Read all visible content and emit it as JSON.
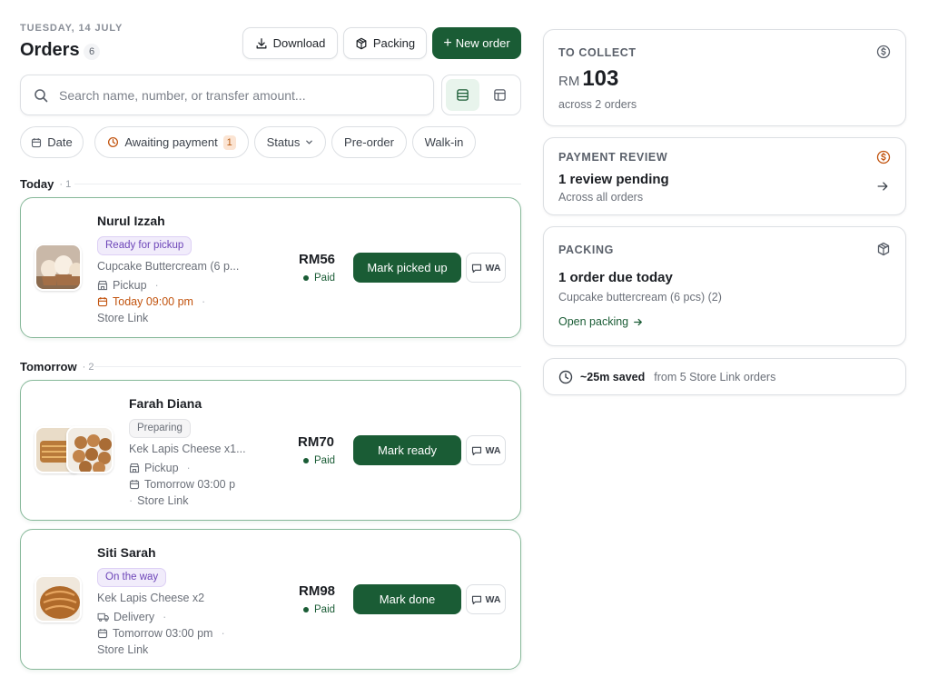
{
  "header": {
    "date": "TUESDAY, 14 JULY",
    "title": "Orders",
    "count": "6",
    "download_label": "Download",
    "packing_label": "Packing",
    "new_order_label": "New order"
  },
  "search": {
    "placeholder": "Search name, number, or transfer amount..."
  },
  "view_toggle": [
    "list-view",
    "table-view"
  ],
  "filters": {
    "date": "Date",
    "awaiting": "Awaiting payment",
    "awaiting_count": "1",
    "status": "Status",
    "preorder": "Pre-order",
    "walkin": "Walk-in"
  },
  "groups": [
    {
      "label": "Today",
      "count": "1"
    },
    {
      "label": "Tomorrow",
      "count": "2"
    }
  ],
  "orders": [
    {
      "name": "Nurul Izzah",
      "status": "Ready for pickup",
      "item": "Cupcake Buttercream (6 p...",
      "method": "Pickup",
      "time": "Today 09:00 pm",
      "channel": "Store Link",
      "price": "RM56",
      "payment": "Paid",
      "action": "Mark picked up",
      "wa": "WA"
    },
    {
      "name": "Farah Diana",
      "status": "Preparing",
      "item": "Kek Lapis Cheese x1...",
      "method": "Pickup",
      "time": "Tomorrow 03:00 p",
      "channel": "Store Link",
      "price": "RM70",
      "payment": "Paid",
      "action": "Mark ready",
      "wa": "WA"
    },
    {
      "name": "Siti Sarah",
      "status": "On the way",
      "item": "Kek Lapis Cheese x2",
      "method": "Delivery",
      "time": "Tomorrow 03:00 pm",
      "channel": "Store Link",
      "price": "RM98",
      "payment": "Paid",
      "action": "Mark done",
      "wa": "WA"
    }
  ],
  "summary": {
    "collect": {
      "heading": "TO COLLECT",
      "currency": "RM",
      "amount": "103",
      "sub": "across 2 orders"
    },
    "review": {
      "heading": "PAYMENT REVIEW",
      "main": "1 review pending",
      "sub": "Across all orders"
    },
    "packing": {
      "heading": "PACKING",
      "main": "1 order due today",
      "sub": "Cupcake buttercream (6 pcs) (2)",
      "link": "Open packing"
    },
    "saved": {
      "main": "~25m saved",
      "sub": "from 5 Store Link orders"
    }
  },
  "colors": {
    "brand_green": "#1a5c35",
    "card_border": "#86b899",
    "purple_badge": "#6d45b8",
    "orange_accent": "#c2540f"
  }
}
